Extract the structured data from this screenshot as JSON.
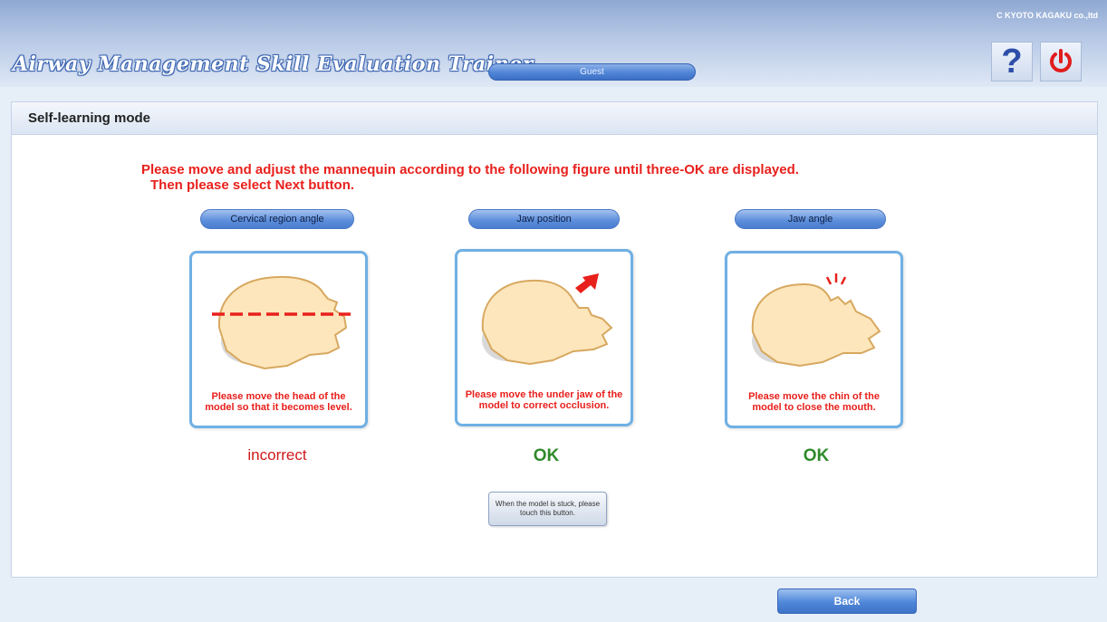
{
  "header": {
    "app_title": "Airway Management Skill Evaluation Trainer",
    "user_label": "Guest",
    "copyright": "C KYOTO KAGAKU co.,ltd",
    "help_label": "?"
  },
  "mode": {
    "title": "Self-learning mode"
  },
  "instruction": {
    "line1": "Please move and adjust the mannequin according to the following figure until three-OK are displayed.",
    "line2": "Then please select Next button."
  },
  "checks": [
    {
      "label": "Cervical region angle",
      "message": "Please move the head of the model so that it becomes level.",
      "status": "incorrect"
    },
    {
      "label": "Jaw position",
      "message": "Please move the under jaw of the model to correct occlusion.",
      "status": "OK"
    },
    {
      "label": "Jaw angle",
      "message": "Please move the chin of the model to close the mouth.",
      "status": "OK"
    }
  ],
  "stuck_button": "When the model is stuck, please touch this button.",
  "back_button": "Back",
  "colors": {
    "instruction_red": "#e8201c",
    "ok_green": "#2f8a2a",
    "incorrect_red": "#d0191a",
    "accent_blue": "#4f84d6"
  },
  "icons": [
    "help-icon",
    "power-icon"
  ]
}
